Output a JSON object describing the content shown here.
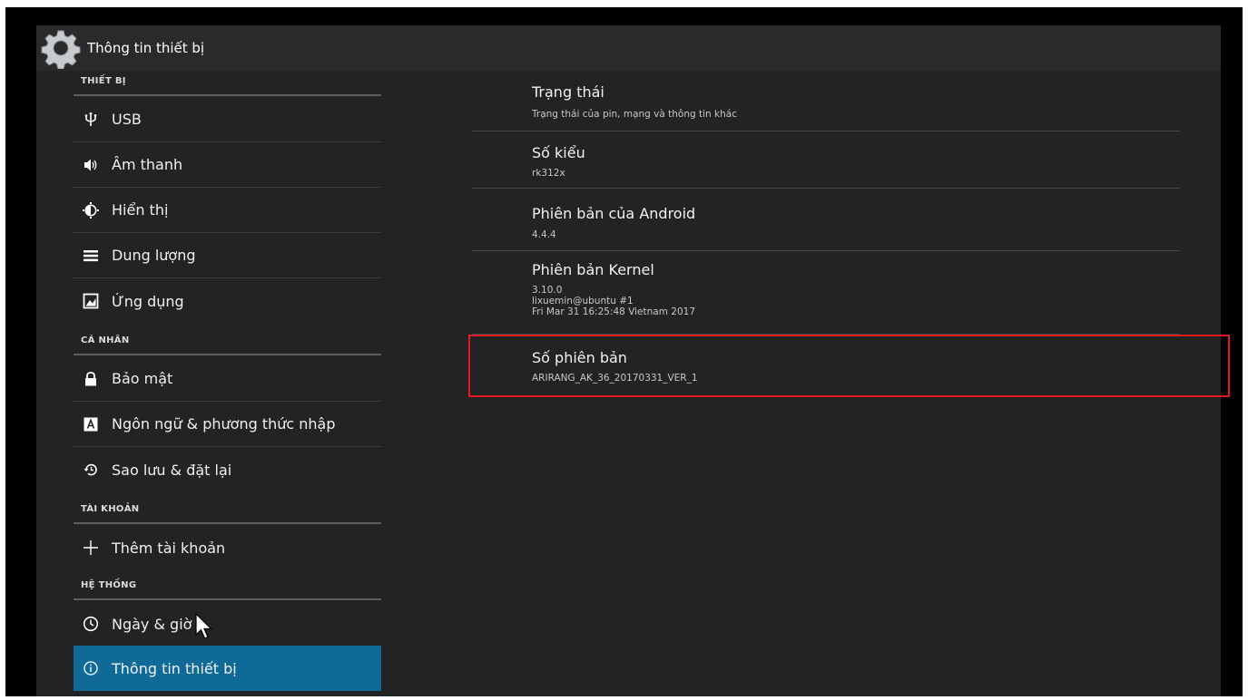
{
  "titlebar": {
    "title": "Thông tin thiết bị",
    "icon": "gear-icon"
  },
  "sidebar": {
    "sections": [
      {
        "header": "THIẾT BỊ"
      },
      {
        "header": "CÁ NHÂN"
      },
      {
        "header": "TÀI KHOẢN"
      },
      {
        "header": "HỆ THỐNG"
      }
    ],
    "items": [
      {
        "label": "USB",
        "icon": "usb-icon"
      },
      {
        "label": "Âm thanh",
        "icon": "speaker-icon"
      },
      {
        "label": "Hiển thị",
        "icon": "brightness-icon"
      },
      {
        "label": "Dung lượng",
        "icon": "storage-icon"
      },
      {
        "label": "Ứng dụng",
        "icon": "apps-icon"
      },
      {
        "label": "Bảo mật",
        "icon": "lock-icon"
      },
      {
        "label": "Ngôn ngữ & phương thức nhập",
        "icon": "language-icon"
      },
      {
        "label": "Sao lưu & đặt lại",
        "icon": "backup-icon"
      },
      {
        "label": "Thêm tài khoản",
        "icon": "plus-icon"
      },
      {
        "label": "Ngày & giờ",
        "icon": "clock-icon"
      },
      {
        "label": "Thông tin thiết bị",
        "icon": "info-icon",
        "selected": true
      }
    ]
  },
  "details": {
    "items": [
      {
        "title": "Trạng thái",
        "lines": [
          "Trạng thái của pin, mạng và thông tin khác"
        ]
      },
      {
        "title": "Số kiểu",
        "lines": [
          "rk312x"
        ]
      },
      {
        "title": "Phiên bản của Android",
        "lines": [
          "4.4.4"
        ]
      },
      {
        "title": "Phiên bản Kernel",
        "lines": [
          "3.10.0",
          "lixuemin@ubuntu #1",
          "Fri Mar 31 16:25:48 Vietnam 2017"
        ]
      },
      {
        "title": "Số phiên bản",
        "lines": [
          "ARIRANG_AK_36_20170331_VER_1"
        ]
      }
    ]
  },
  "colors": {
    "background": "#212324",
    "titlebar": "#2a2a2a",
    "selected": "#0f6a98",
    "highlight_box": "#e01a22"
  }
}
